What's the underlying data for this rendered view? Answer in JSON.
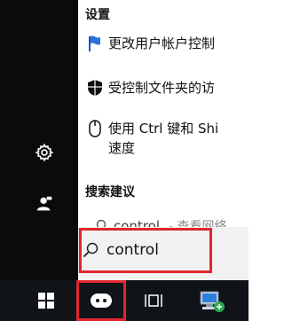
{
  "menu": {
    "settings_section": "设置",
    "items": [
      {
        "label": "更改用户帐户控制",
        "icon": "flag-icon"
      },
      {
        "label": "受控制文件夹的访",
        "icon": "shield-icon"
      },
      {
        "label_line1": "使用 Ctrl 键和 Shi",
        "label_line2": "速度",
        "icon": "mouse-icon"
      }
    ],
    "search_suggestions_section": "搜索建议",
    "suggestion": {
      "text": "control",
      "suffix": "- 查看网络"
    }
  },
  "sidebar": {
    "icons": [
      "gear-icon",
      "person-icon"
    ]
  },
  "search": {
    "query": "control"
  },
  "taskbar": {
    "items": [
      "windows-start-icon",
      "cortana-icon",
      "task-view-icon",
      "network-icon"
    ]
  },
  "colors": {
    "highlight": "#e2262e",
    "taskbar": "#101317",
    "rail": "#0b0b0b"
  }
}
